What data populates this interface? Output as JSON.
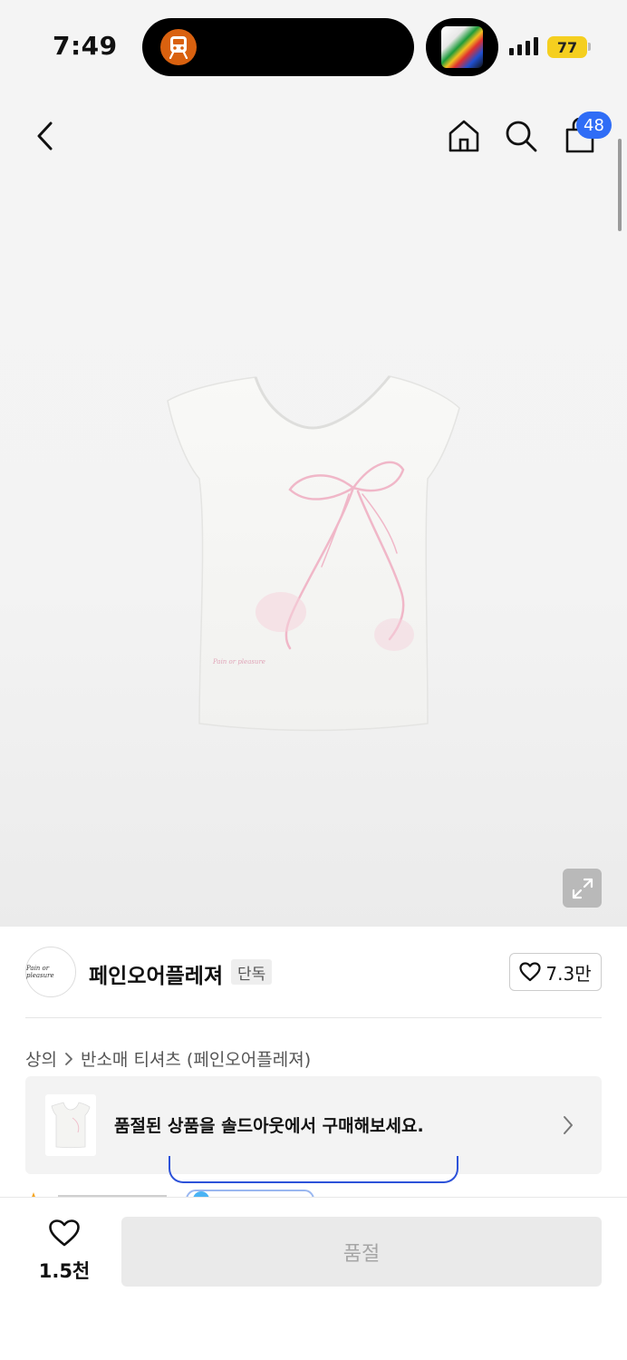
{
  "status_bar": {
    "time": "7:49",
    "battery": "77",
    "battery_color": "#f5cf1f"
  },
  "nav": {
    "cart_count": "48",
    "badge_color": "#2f6df6",
    "icons": [
      "back-icon",
      "home-icon",
      "search-icon",
      "cart-icon"
    ]
  },
  "product": {
    "image_alt": "white cap-sleeve t-shirt with pink ribbon print",
    "shirt_print": "Pain or pleasure"
  },
  "brand": {
    "logo_text": "Pain or pleasure",
    "name": "페인오어플레져",
    "tag": "단독",
    "likes": "7.3만"
  },
  "breadcrumb": {
    "category": "상의",
    "subcategory": "반소매 티셔츠 (페인오어플레져)"
  },
  "soldout_banner": {
    "text": "품절된 상품을 솔드아웃에서 구매해보세요."
  },
  "bottom_bar": {
    "wish_count": "1.5천",
    "action_label": "품절"
  }
}
